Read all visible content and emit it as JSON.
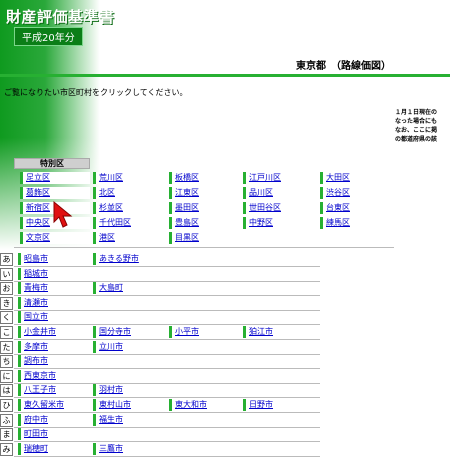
{
  "header": {
    "title": "財産評価基準書",
    "subtitle": "平成20年分"
  },
  "page": {
    "heading": "東京都　（路線価図）",
    "instruction": "ご覧になりたい市区町村をクリックしてください。",
    "notice_lines": [
      "１月１日現在の",
      "なった場合にも",
      "なお、ここに掲",
      "の都道府県の該"
    ]
  },
  "special_wards": {
    "header": "特別区",
    "rows": [
      [
        "足立区",
        "荒川区",
        "板橋区",
        "江戸川区",
        "大田区"
      ],
      [
        "葛飾区",
        "北区",
        "江東区",
        "品川区",
        "渋谷区"
      ],
      [
        "新宿区",
        "杉並区",
        "墨田区",
        "世田谷区",
        "台東区"
      ],
      [
        "中央区",
        "千代田区",
        "豊島区",
        "中野区",
        "練馬区"
      ],
      [
        "文京区",
        "港区",
        "目黒区",
        "",
        ""
      ]
    ]
  },
  "cities": [
    {
      "kana": "あ",
      "items": [
        "昭島市",
        "あきる野市"
      ]
    },
    {
      "kana": "い",
      "items": [
        "稲城市"
      ]
    },
    {
      "kana": "お",
      "items": [
        "青梅市",
        "大島町"
      ]
    },
    {
      "kana": "き",
      "items": [
        "清瀬市"
      ]
    },
    {
      "kana": "く",
      "items": [
        "国立市"
      ]
    },
    {
      "kana": "こ",
      "items": [
        "小金井市",
        "国分寺市",
        "小平市",
        "狛江市"
      ]
    },
    {
      "kana": "た",
      "items": [
        "多摩市",
        "立川市"
      ]
    },
    {
      "kana": "ち",
      "items": [
        "調布市"
      ]
    },
    {
      "kana": "に",
      "items": [
        "西東京市"
      ]
    },
    {
      "kana": "は",
      "items": [
        "八王子市",
        "羽村市"
      ]
    },
    {
      "kana": "ひ",
      "items": [
        "東久留米市",
        "東村山市",
        "東大和市",
        "日野市"
      ]
    },
    {
      "kana": "ふ",
      "items": [
        "府中市",
        "福生市"
      ]
    },
    {
      "kana": "ま",
      "items": [
        "町田市"
      ]
    },
    {
      "kana": "み",
      "items": [
        "瑞穂町",
        "三鷹市"
      ]
    }
  ],
  "colors": {
    "brand_green": "#27b032",
    "link_blue": "#0000cc",
    "cursor_red": "#e01010"
  }
}
